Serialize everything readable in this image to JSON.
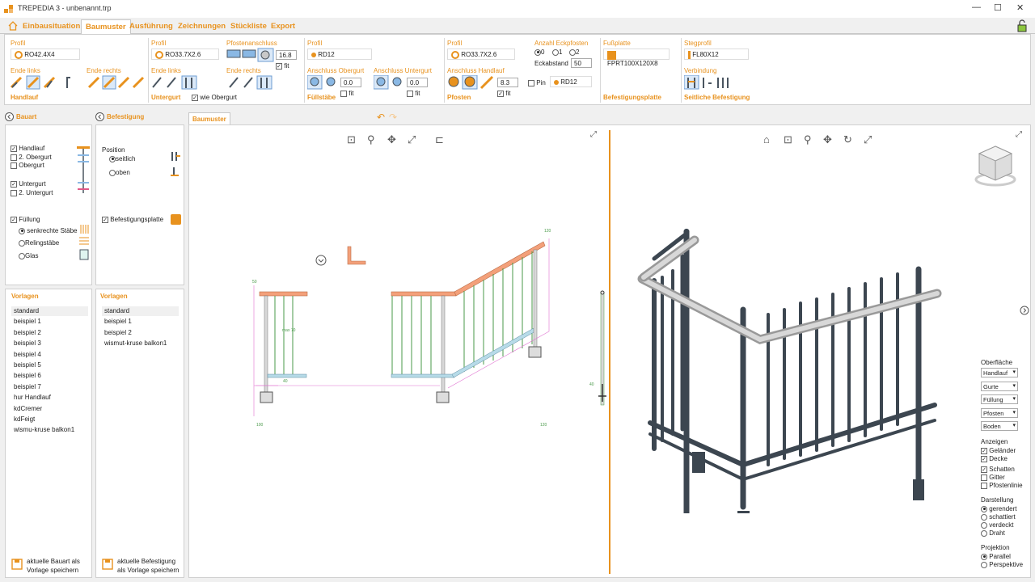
{
  "window": {
    "title": "TREPEDIA 3 - unbenannt.trp",
    "minimize": "—",
    "maximize": "☐",
    "close": "✕"
  },
  "menu": {
    "items": [
      "Einbausituation",
      "Baumuster",
      "Ausführung",
      "Zeichnungen",
      "Stückliste",
      "Export"
    ],
    "active": "Baumuster"
  },
  "ribbon": {
    "handlauf": {
      "profil_label": "Profil",
      "profil_value": "RO42.4X4",
      "ende_links": "Ende links",
      "ende_rechts": "Ende rechts",
      "group": "Handlauf"
    },
    "untergurt": {
      "profil_label": "Profil",
      "profil_value": "RO33.7X2.6",
      "ende_links": "Ende links",
      "group": "Untergurt",
      "wie_obergurt": "wie Obergurt",
      "pfostenanschluss": "Pfostenanschluss",
      "pfosten_value": "16.8",
      "fit": "fit",
      "ende_rechts": "Ende rechts"
    },
    "fuellstaebe": {
      "profil_label": "Profil",
      "profil_value": "RD12",
      "anschluss_obergurt": "Anschluss Obergurt",
      "anschluss_untergurt": "Anschluss Untergurt",
      "ao_value": "0.0",
      "au_value": "0.0",
      "fit": "fit",
      "group": "Füllstäbe"
    },
    "pfosten": {
      "profil_label": "Profil",
      "profil_value": "RO33.7X2.6",
      "anschluss_handlauf": "Anschluss Handlauf",
      "ah_value": "8.3",
      "fit": "fit",
      "group": "Pfosten",
      "anzahl_eckpfosten": "Anzahl Eckpfosten",
      "opt0": "0",
      "opt1": "1",
      "opt2": "2",
      "eckabstand_label": "Eckabstand",
      "eckabstand_value": "50",
      "pin": "Pin",
      "pin_value": "RD12"
    },
    "fussplatte": {
      "label": "Fußplatte",
      "value": "FPRT100X120X8",
      "group": "Befestigungsplatte"
    },
    "steg": {
      "label": "Stegprofil",
      "value": "FL80X12",
      "verbindung": "Verbindung",
      "group": "Seitliche Befestigung"
    }
  },
  "bauart": {
    "header": "Bauart",
    "items": [
      {
        "label": "Handlauf",
        "checked": true
      },
      {
        "label": "2. Obergurt",
        "checked": false
      },
      {
        "label": "Obergurt",
        "checked": false
      },
      {
        "label": "Untergurt",
        "checked": true
      },
      {
        "label": "2. Untergurt",
        "checked": false
      }
    ],
    "fuellung": "Füllung",
    "fuellung_checked": true,
    "options": [
      "senkrechte Stäbe",
      "Relingstäbe",
      "Glas"
    ],
    "selected": "senkrechte Stäbe"
  },
  "befestigung": {
    "header": "Befestigung",
    "position_label": "Position",
    "seitlich": "seitlich",
    "oben": "oben",
    "befestigungsplatte": "Befestigungsplatte",
    "checked": true
  },
  "vorlagen_left": {
    "header": "Vorlagen",
    "items": [
      "standard",
      "beispiel 1",
      "beispiel 2",
      "beispiel 3",
      "beispiel 4",
      "beispiel 5",
      "beispiel 6",
      "beispiel 7",
      "hur Handlauf",
      "kdCremer",
      "kdFeigt",
      "wismu-kruse balkon1"
    ],
    "save_line1": "aktuelle Bauart als",
    "save_line2": "Vorlage speichern"
  },
  "vorlagen_right": {
    "header": "Vorlagen",
    "items": [
      "standard",
      "beispiel 1",
      "beispiel 2",
      "wismut-kruse balkon1"
    ],
    "save_line1": "aktuelle Befestigung",
    "save_line2": "als Vorlage speichern"
  },
  "tab": {
    "label": "Baumuster"
  },
  "drawing": {
    "dims": [
      "50",
      "max 70",
      "40",
      "100",
      "120",
      "30",
      "40"
    ]
  },
  "oberflaeche": {
    "header": "Oberfläche",
    "selects": [
      "Handlauf",
      "Gurte",
      "Füllung",
      "Pfosten",
      "Boden"
    ]
  },
  "anzeigen": {
    "header": "Anzeigen",
    "items": [
      {
        "label": "Geländer",
        "checked": true
      },
      {
        "label": "Decke",
        "checked": true
      },
      {
        "label": "Schatten",
        "checked": true
      },
      {
        "label": "Gitter",
        "checked": false
      },
      {
        "label": "Pfostenlinie",
        "checked": false
      }
    ]
  },
  "darstellung": {
    "header": "Darstellung",
    "options": [
      "gerendert",
      "schattiert",
      "verdeckt",
      "Draht"
    ],
    "selected": "gerendert"
  },
  "projektion": {
    "header": "Projektion",
    "options": [
      "Parallel",
      "Perspektive"
    ],
    "selected": "Parallel"
  },
  "colors": {
    "accent": "#e8921e",
    "post": "#4a5560",
    "rail": "#c8c8c8"
  }
}
